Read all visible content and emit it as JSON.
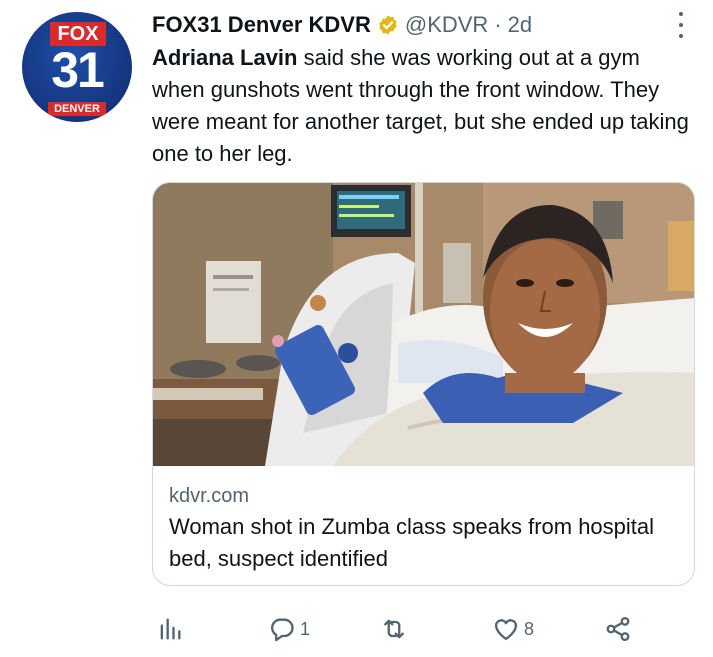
{
  "author": {
    "display_name": "FOX31 Denver KDVR",
    "handle": "@KDVR",
    "separator": "·",
    "time": "2d",
    "avatar": {
      "top_text": "FOX",
      "number": "31",
      "bottom_text": "DENVER"
    }
  },
  "tweet": {
    "mention": "Adriana Lavin",
    "body": " said she was working out at a gym when gunshots went through the front window. They were meant for another target, but she ended up taking one to her leg."
  },
  "card": {
    "domain": "kdvr.com",
    "title": "Woman shot in Zumba class speaks from hospital bed, suspect identified"
  },
  "actions": {
    "analytics_icon": "bar-chart-icon",
    "reply_count": "1",
    "retweet_count": "",
    "like_count": "8",
    "share_icon": "share-icon"
  },
  "colors": {
    "text": "#0f1419",
    "secondary": "#536471",
    "verified": "#e2b719",
    "border": "#cfd9de",
    "brand_red": "#d92b2b",
    "brand_blue": "#163a86"
  }
}
